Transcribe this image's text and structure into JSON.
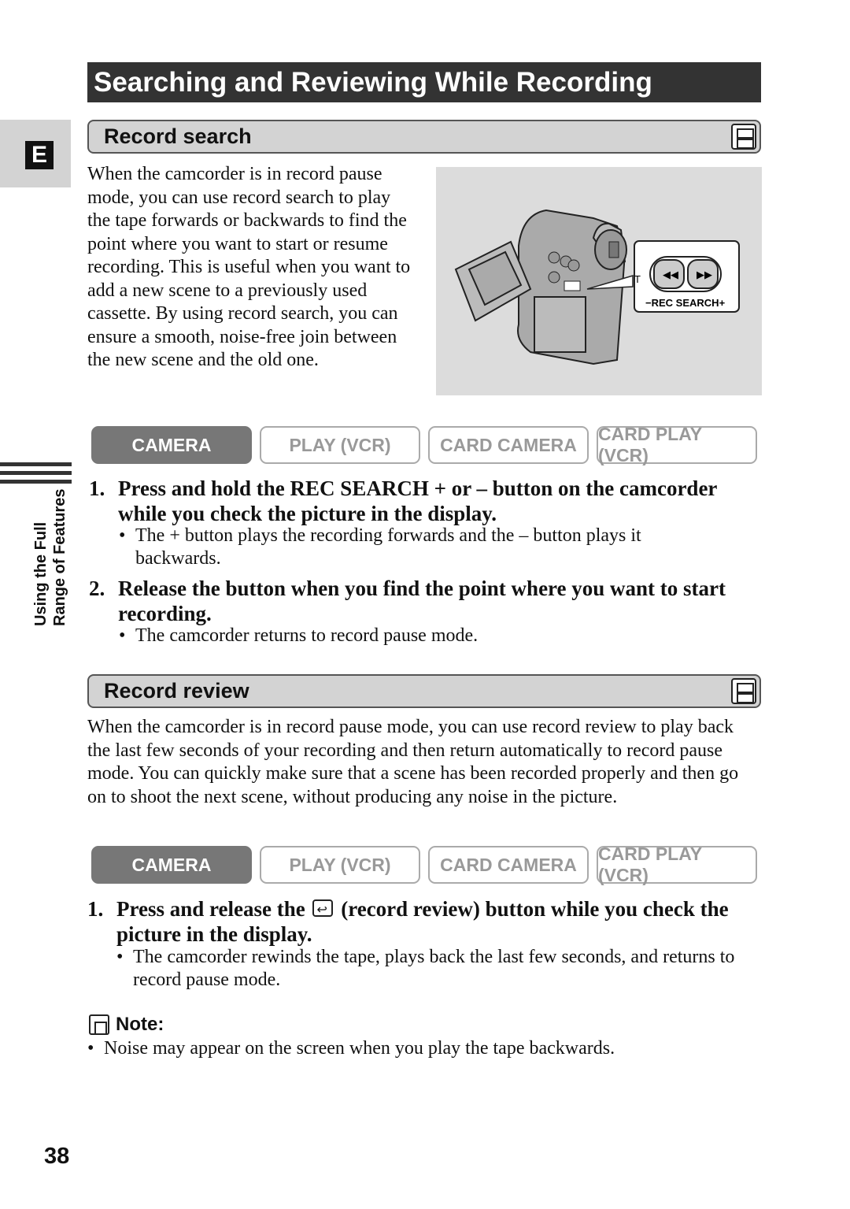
{
  "title": "Searching and Reviewing While Recording",
  "side_tab": {
    "letter": "E",
    "chapter_line1": "Using the Full",
    "chapter_line2": "Range of Features"
  },
  "record_search": {
    "heading": "Record search",
    "icon": "tape-icon",
    "intro": "When the camcorder is in record pause mode, you can use record search to play the tape forwards or backwards to find the point where you want to start or resume recording. This is useful when you want to add a new scene to a previously used cassette. By using record search, you can ensure a smooth, noise-free join between the new scene and the old one.",
    "illustration": {
      "label_minus": "−",
      "label_text": "REC SEARCH",
      "label_plus": "+",
      "callout_char": "T"
    },
    "modes": [
      {
        "label": "CAMERA",
        "active": true
      },
      {
        "label": "PLAY (VCR)",
        "active": false
      },
      {
        "label": "CARD CAMERA",
        "active": false
      },
      {
        "label": "CARD PLAY (VCR)",
        "active": false
      }
    ],
    "steps": [
      {
        "num": "1.",
        "text": "Press and hold the REC SEARCH + or – button on the camcorder while you check the picture in the display.",
        "bullet": "The + button plays the recording forwards and the – button plays it backwards."
      },
      {
        "num": "2.",
        "text": "Release the button when you find the point where you want to start recording.",
        "bullet": "The camcorder returns to record pause mode."
      }
    ]
  },
  "record_review": {
    "heading": "Record review",
    "icon": "tape-icon",
    "intro": "When the camcorder is in record pause mode, you can use record review to play back the last few seconds of your recording and then return automatically to record pause mode. You can quickly make sure that a scene has been recorded properly and then go on to shoot the next scene, without producing any noise in the picture.",
    "modes": [
      {
        "label": "CAMERA",
        "active": true
      },
      {
        "label": "PLAY (VCR)",
        "active": false
      },
      {
        "label": "CARD CAMERA",
        "active": false
      },
      {
        "label": "CARD PLAY (VCR)",
        "active": false
      }
    ],
    "step": {
      "num": "1.",
      "text_before": "Press and release the",
      "text_after": "(record review) button while you check the picture in the display.",
      "bullet": "The camcorder rewinds the tape, plays back the last few seconds, and returns to record pause mode."
    }
  },
  "note": {
    "heading": "Note:",
    "bullet": "Noise may appear on the screen when you play the tape backwards."
  },
  "bullet_char": "•",
  "page_number": "38"
}
